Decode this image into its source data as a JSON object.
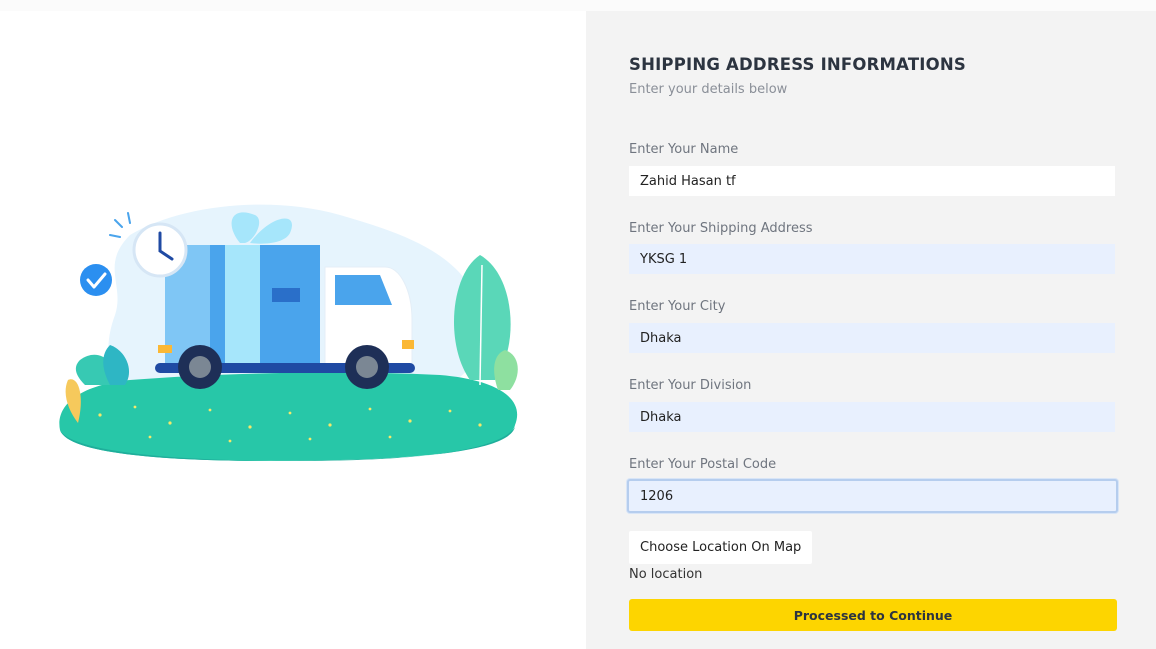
{
  "form": {
    "title": "SHIPPING ADDRESS INFORMATIONS",
    "subtitle": "Enter your details below",
    "fields": [
      {
        "label": "Enter Your Name",
        "value": "Zahid Hasan tf"
      },
      {
        "label": "Enter Your Shipping Address",
        "value": "YKSG 1"
      },
      {
        "label": "Enter Your City",
        "value": "Dhaka"
      },
      {
        "label": "Enter Your Division",
        "value": "Dhaka"
      },
      {
        "label": "Enter Your Postal Code",
        "value": "1206"
      }
    ],
    "map_button_label": "Choose Location On Map",
    "location_status": "No location",
    "continue_label": "Processed to Continue"
  },
  "colors": {
    "accent_button": "#fdd500",
    "autofill_field": "#e8f0fe",
    "panel_background": "#f3f3f3"
  }
}
